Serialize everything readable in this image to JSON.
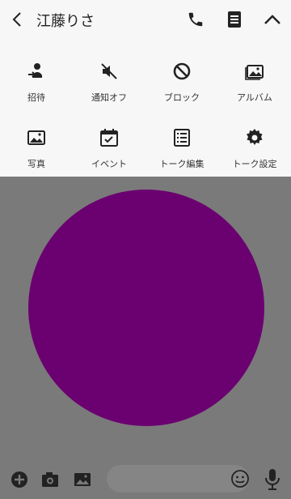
{
  "header": {
    "title": "江藤りさ"
  },
  "menu": {
    "items": [
      {
        "label": "招待",
        "icon": "add-friend-icon"
      },
      {
        "label": "通知オフ",
        "icon": "mute-icon"
      },
      {
        "label": "ブロック",
        "icon": "block-icon"
      },
      {
        "label": "アルバム",
        "icon": "album-icon"
      },
      {
        "label": "写真",
        "icon": "photo-icon"
      },
      {
        "label": "イベント",
        "icon": "calendar-icon"
      },
      {
        "label": "トーク編集",
        "icon": "edit-list-icon"
      },
      {
        "label": "トーク設定",
        "icon": "gear-icon"
      }
    ]
  },
  "colors": {
    "header_bg": "#f7f7f7",
    "chat_bg": "#7a7a7a",
    "circle": "#6b0070",
    "icon": "#222222"
  }
}
